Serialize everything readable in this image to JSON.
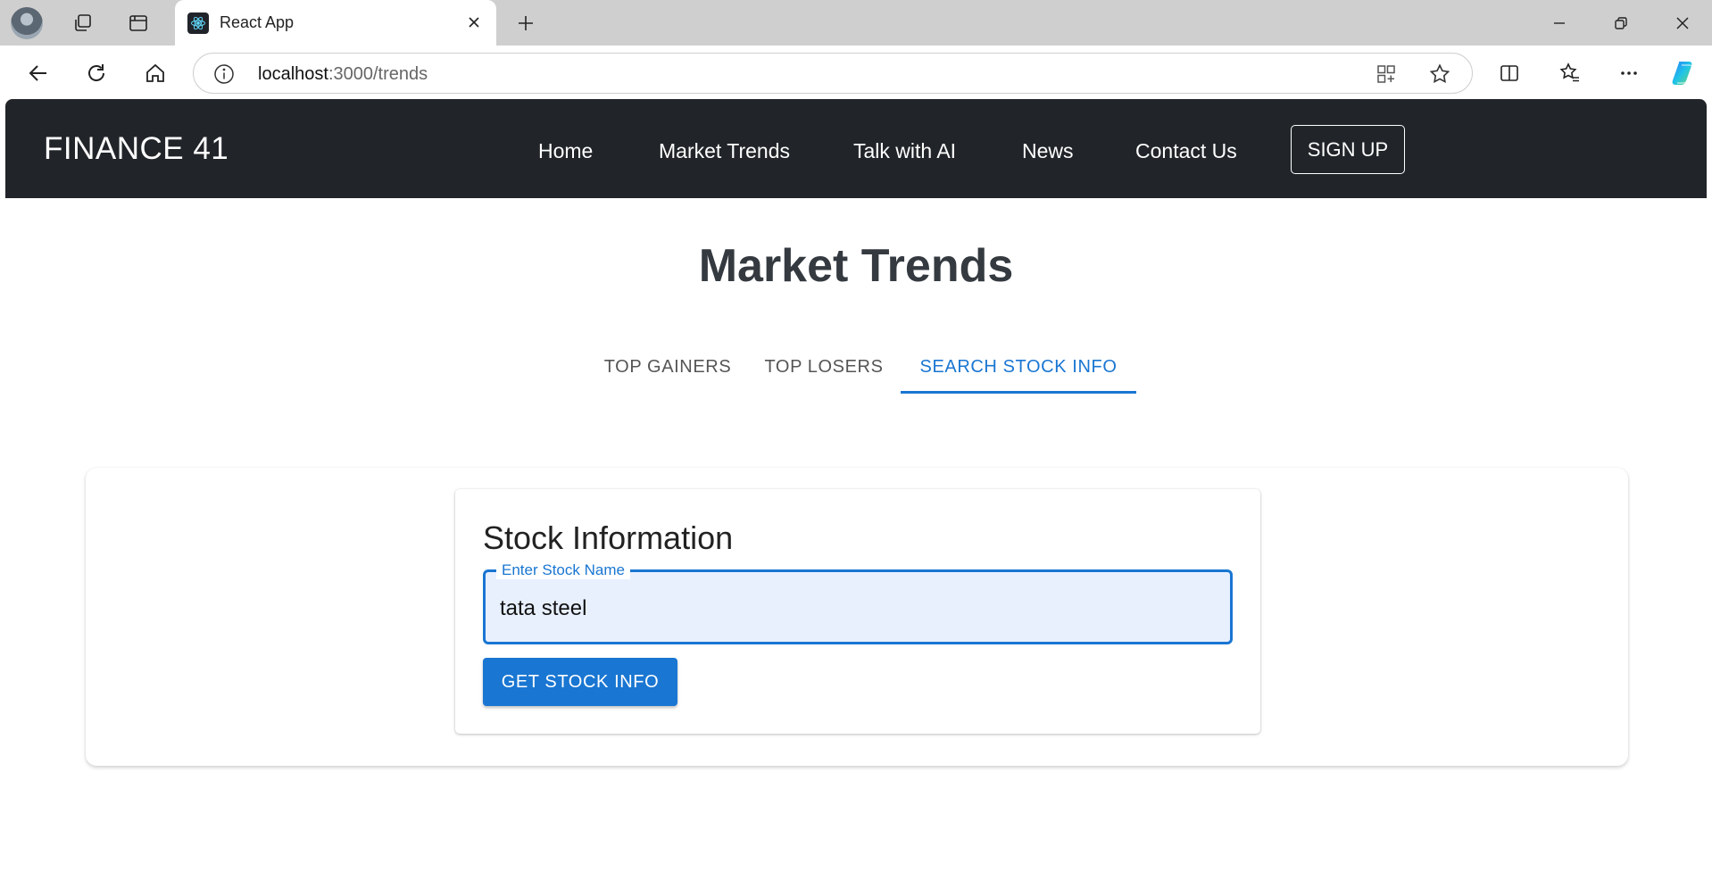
{
  "browser": {
    "tab_title": "React App",
    "url_host": "localhost",
    "url_path": ":3000/trends"
  },
  "navbar": {
    "brand": "FINANCE 41",
    "links": [
      "Home",
      "Market Trends",
      "Talk with AI",
      "News",
      "Contact Us"
    ],
    "signup_label": "SIGN UP"
  },
  "page": {
    "heading": "Market Trends",
    "tabs": [
      "TOP GAINERS",
      "TOP LOSERS",
      "SEARCH STOCK INFO"
    ],
    "active_tab": "SEARCH STOCK INFO"
  },
  "stock_card": {
    "title": "Stock Information",
    "input_label": "Enter Stock Name",
    "input_value": "tata steel",
    "button_label": "GET STOCK INFO"
  },
  "colors": {
    "navbar_bg": "#212529",
    "accent": "#1976d2",
    "heading": "#343a40"
  },
  "icons": [
    "profile-avatar",
    "workspaces-icon",
    "tab-actions-icon",
    "react-favicon",
    "close-icon",
    "plus-icon",
    "minimize-icon",
    "restore-icon",
    "window-close-icon",
    "back-arrow-icon",
    "refresh-icon",
    "home-icon",
    "info-icon",
    "apps-icon",
    "star-icon",
    "split-screen-icon",
    "favorites-icon",
    "more-icon",
    "copilot-icon"
  ]
}
